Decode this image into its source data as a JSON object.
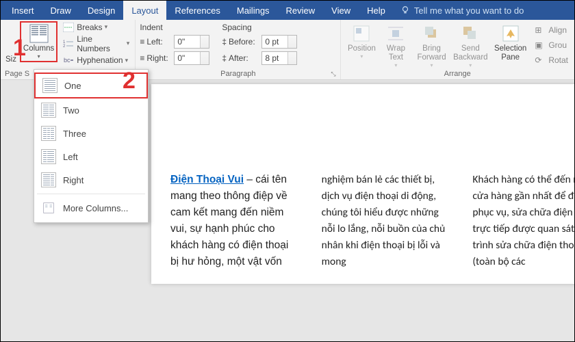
{
  "tabs": [
    "Insert",
    "Draw",
    "Design",
    "Layout",
    "References",
    "Mailings",
    "Review",
    "View",
    "Help"
  ],
  "active_tab": "Layout",
  "tellme": "Tell me what you want to do",
  "ribbon": {
    "size_cut": "Siz",
    "columns_label": "Columns",
    "breaks": "Breaks",
    "line_numbers": "Line Numbers",
    "hyphenation": "Hyphenation",
    "page_setup_label": "Page S",
    "paragraph_label": "Paragraph",
    "arrange_label": "Arrange",
    "indent_label": "Indent",
    "spacing_label": "Spacing",
    "left_label": "Left:",
    "right_label": "Right:",
    "before_label": "Before:",
    "after_label": "After:",
    "left_val": "0\"",
    "right_val": "0\"",
    "before_val": "0 pt",
    "after_val": "8 pt",
    "position": "Position",
    "wrap_text": "Wrap Text",
    "bring_forward": "Bring Forward",
    "send_backward": "Send Backward",
    "selection_pane": "Selection Pane",
    "align": "Align",
    "group": "Grou",
    "rotate": "Rotat"
  },
  "dropdown": {
    "items": [
      "One",
      "Two",
      "Three",
      "Left",
      "Right"
    ],
    "more": "More Columns..."
  },
  "annotations": {
    "one": "1",
    "two": "2"
  },
  "document": {
    "link_text": "Điện Thoại Vui",
    "col1": " – cái tên mang theo thông điệp về cam kết mang đến niềm vui, sự hạnh phúc cho khách hàng có điện thoại bị hư hỏng, một vật vốn",
    "col2": "nghiệm bán lẻ các thiết bị, dịch vụ điện thoại di động, chúng tôi hiểu được những nỗi lo lắng, nỗi buồn của chủ nhân khi điện thoại bị lỗi và mong",
    "col3": "Khách hàng có thể đến nhiều cửa hàng gần nhất để được phục vụ, sửa chữa điện thoại trực tiếp được quan sát quá trình sửa chữa điện thoại (toàn bộ các"
  }
}
